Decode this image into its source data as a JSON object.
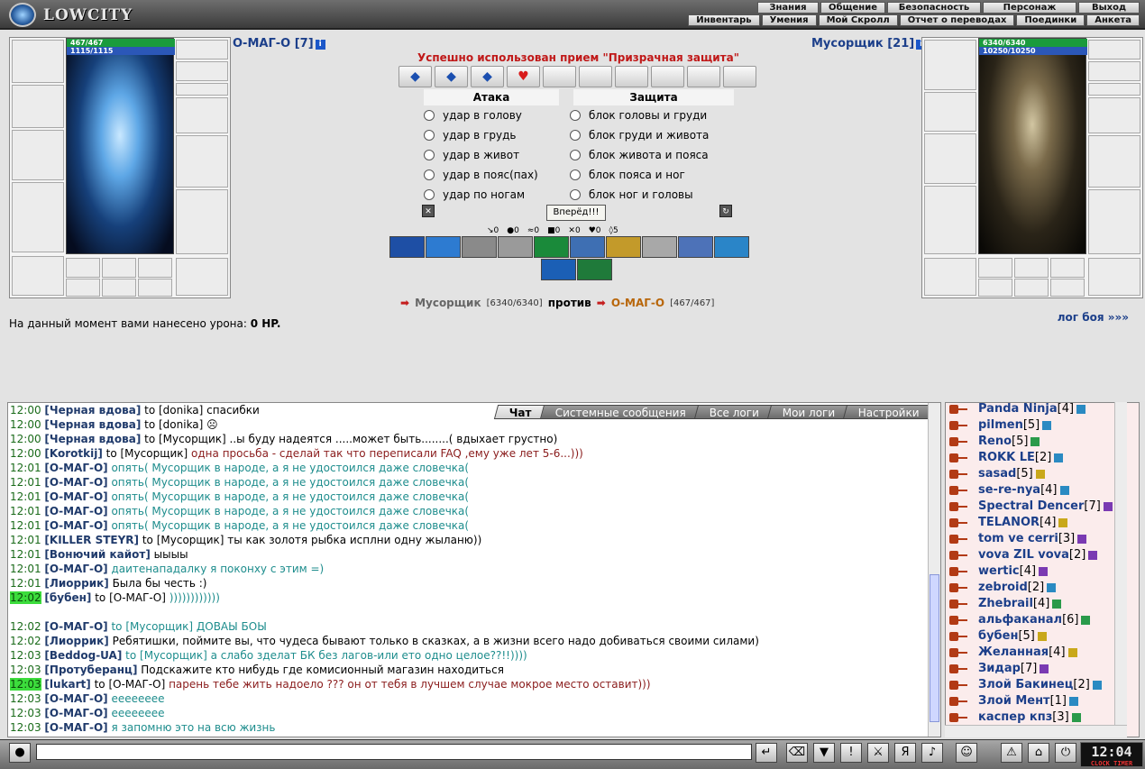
{
  "app": {
    "logo_text": "LOWCITY"
  },
  "menu": {
    "row1": [
      "Знания",
      "Общение",
      "Безопасность",
      "Персонаж",
      "Выход"
    ],
    "row2": [
      "Инвентарь",
      "Умения",
      "Мой Скролл",
      "Отчет о переводах",
      "Поединки",
      "Анкета"
    ]
  },
  "player": {
    "name": "О-МАГ-О",
    "level": "[7]",
    "hp": "467/467",
    "mp": "1115/1115"
  },
  "opponent": {
    "name": "Мусорщик",
    "level": "[21]",
    "hp": "6340/6340",
    "mp": "10250/10250"
  },
  "battle": {
    "message": "Успешно использован прием \"Призрачная защита\"",
    "attack_header": "Атака",
    "defense_header": "Защита",
    "attacks": [
      "удар в голову",
      "удар в грудь",
      "удар в живот",
      "удар в пояс(пах)",
      "удар по ногам"
    ],
    "blocks": [
      "блок головы и груди",
      "блок груди и живота",
      "блок живота и пояса",
      "блок пояса и ног",
      "блок ног и головы"
    ],
    "forward_button": "Вперёд!!!",
    "counters": [
      "0",
      "0",
      "0",
      "0",
      "0",
      "0",
      "5"
    ],
    "versus_word": "против",
    "damage_label": "На данный момент вами нанесено урона:",
    "damage_value": "0 HP.",
    "log_link": "лог боя »»»"
  },
  "chat": {
    "tabs": [
      "Чат",
      "Системные сообщения",
      "Все логи",
      "Мои логи",
      "Настройки"
    ],
    "lines": [
      {
        "t": "12:00",
        "who": "[Черная вдова]",
        "mid": " to [donika] ",
        "txt": "спасибки",
        "cls": ""
      },
      {
        "t": "12:00",
        "who": "[Черная вдова]",
        "mid": " to [donika] ",
        "txt": "☹",
        "cls": ""
      },
      {
        "t": "12:00",
        "who": "[Черная вдова]",
        "mid": " to [Мусорщик] ",
        "txt": "..ы буду надеятся .....может быть........( вдыхает грустно)",
        "cls": ""
      },
      {
        "t": "12:00",
        "who": "[Korotkij]",
        "mid": " to [Мусорщик] ",
        "txt": "одна просьба - сделай так что переписали FAQ ,ему уже лет 5-6...)))",
        "cls": "sys"
      },
      {
        "t": "12:01",
        "who": "[О-МАГ-О]",
        "mid": " ",
        "txt": "опять( Мусорщик в народе, а я не удостоился даже словечка(",
        "cls": "priv"
      },
      {
        "t": "12:01",
        "who": "[О-МАГ-О]",
        "mid": " ",
        "txt": "опять( Мусорщик в народе, а я не удостоился даже словечка(",
        "cls": "priv"
      },
      {
        "t": "12:01",
        "who": "[О-МАГ-О]",
        "mid": " ",
        "txt": "опять( Мусорщик в народе, а я не удостоился даже словечка(",
        "cls": "priv"
      },
      {
        "t": "12:01",
        "who": "[О-МАГ-О]",
        "mid": " ",
        "txt": "опять( Мусорщик в народе, а я не удостоился даже словечка(",
        "cls": "priv"
      },
      {
        "t": "12:01",
        "who": "[О-МАГ-О]",
        "mid": " ",
        "txt": "опять( Мусорщик в народе, а я не удостоился даже словечка(",
        "cls": "priv"
      },
      {
        "t": "12:01",
        "who": "[KILLER STEYR]",
        "mid": " to [Мусорщик] ",
        "txt": "ты как золотя рыбка исплни одну жыланю))",
        "cls": ""
      },
      {
        "t": "12:01",
        "who": "[Вонючий кайот]",
        "mid": " ",
        "txt": "ыыыы",
        "cls": ""
      },
      {
        "t": "12:01",
        "who": "[О-МАГ-О]",
        "mid": " ",
        "txt": "даитенападалку я поконху с этим =)",
        "cls": "priv"
      },
      {
        "t": "12:01",
        "who": "[Лиоррик]",
        "mid": " ",
        "txt": "Была бы честь :)",
        "cls": ""
      },
      {
        "t": "12:02",
        "who": "[бубен]",
        "mid": " to [О-МАГ-О] ",
        "txt": "))))))))))))",
        "cls": "priv",
        "hl": true
      },
      {
        "t": "",
        "who": "",
        "mid": "",
        "txt": "",
        "cls": ""
      },
      {
        "t": "12:02",
        "who": "[О-МАГ-О]",
        "mid": " ",
        "txt": "to [Мусорщик] ДОВАЫ БОЫ",
        "cls": "priv"
      },
      {
        "t": "12:02",
        "who": "[Лиоррик]",
        "mid": " ",
        "txt": "Ребятишки, поймите вы, что чудеса бывают только в сказках, а в жизни всего надо добиваться своими силами)",
        "cls": ""
      },
      {
        "t": "12:03",
        "who": "[Beddog-UA]",
        "mid": " ",
        "txt": "to [Мусорщик] а слабо зделат БК без лагов-или ето одно целое??!!))))",
        "cls": "priv"
      },
      {
        "t": "12:03",
        "who": "[Протуберанц]",
        "mid": " ",
        "txt": "Подскажите кто нибудь где комисионный магазин находиться",
        "cls": ""
      },
      {
        "t": "12:03",
        "who": "[lukart]",
        "mid": " to [О-МАГ-О] ",
        "txt": "парень тебе жить надоело ??? он от тебя в лучшем случае мокрое место оставит)))",
        "cls": "sys",
        "hl": true
      },
      {
        "t": "12:03",
        "who": "[О-МАГ-О]",
        "mid": " ",
        "txt": "ееееееее",
        "cls": "priv"
      },
      {
        "t": "12:03",
        "who": "[О-МАГ-О]",
        "mid": " ",
        "txt": "ееееееее",
        "cls": "priv"
      },
      {
        "t": "12:03",
        "who": "[О-МАГ-О]",
        "mid": " ",
        "txt": "я запомню это на всю жизнь",
        "cls": "priv"
      }
    ]
  },
  "users": [
    {
      "name": "Panda Ninja",
      "lvl": "[4]",
      "c": "#2a8ac2"
    },
    {
      "name": "pilmen",
      "lvl": "[5]",
      "c": "#2a8ac2"
    },
    {
      "name": "Reno",
      "lvl": "[5]",
      "c": "#2a9a4a"
    },
    {
      "name": "ROKK LE",
      "lvl": "[2]",
      "c": "#2a8ac2"
    },
    {
      "name": "sasad",
      "lvl": "[5]",
      "c": "#c9a81a"
    },
    {
      "name": "se-re-nya",
      "lvl": "[4]",
      "c": "#2a8ac2"
    },
    {
      "name": "Spectral Dencer",
      "lvl": "[7]",
      "c": "#7a3ab2"
    },
    {
      "name": "TELANOR",
      "lvl": "[4]",
      "c": "#c9a81a"
    },
    {
      "name": "tom ve cerri",
      "lvl": "[3]",
      "c": "#7a3ab2"
    },
    {
      "name": "vova ZIL vova",
      "lvl": "[2]",
      "c": "#7a3ab2"
    },
    {
      "name": "wertic",
      "lvl": "[4]",
      "c": "#7a3ab2"
    },
    {
      "name": "zebroid",
      "lvl": "[2]",
      "c": "#2a8ac2"
    },
    {
      "name": "Zhebrail",
      "lvl": "[4]",
      "c": "#2a9a4a"
    },
    {
      "name": "альфаканал",
      "lvl": "[6]",
      "c": "#2a9a4a"
    },
    {
      "name": "бубен",
      "lvl": "[5]",
      "c": "#c9a81a"
    },
    {
      "name": "Желанная",
      "lvl": "[4]",
      "c": "#c9a81a"
    },
    {
      "name": "Зидар",
      "lvl": "[7]",
      "c": "#7a3ab2"
    },
    {
      "name": "Злой Бакинец",
      "lvl": "[2]",
      "c": "#2a8ac2"
    },
    {
      "name": "Злой Мент",
      "lvl": "[1]",
      "c": "#2a8ac2"
    },
    {
      "name": "каспер кпз",
      "lvl": "[3]",
      "c": "#2a9a4a"
    }
  ],
  "clock": {
    "time": "12:04",
    "label": "CLOCK TIMER"
  }
}
